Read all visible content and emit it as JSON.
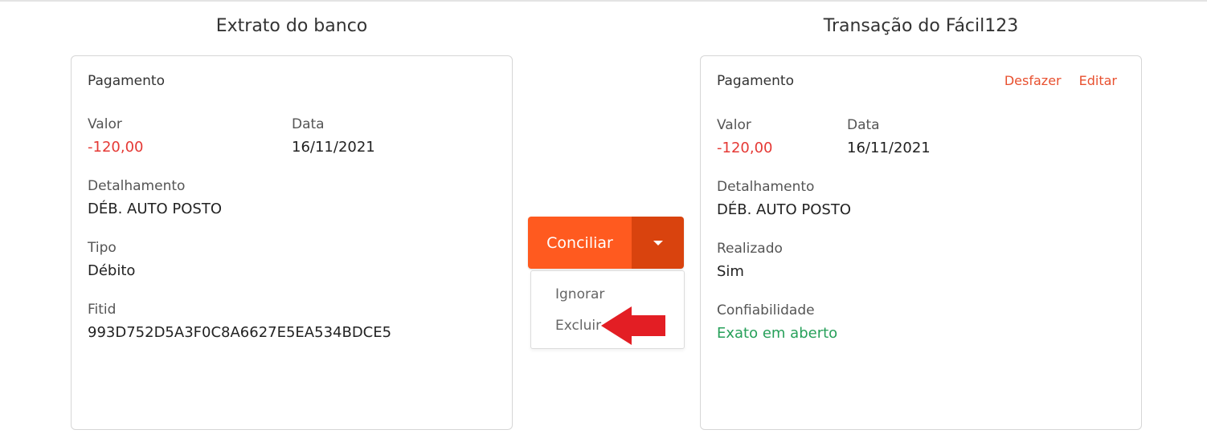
{
  "bank_panel": {
    "heading": "Extrato do banco",
    "card_title": "Pagamento",
    "valor_label": "Valor",
    "valor_value": "-120,00",
    "data_label": "Data",
    "data_value": "16/11/2021",
    "detalhamento_label": "Detalhamento",
    "detalhamento_value": "DÉB. AUTO POSTO",
    "tipo_label": "Tipo",
    "tipo_value": "Débito",
    "fitid_label": "Fitid",
    "fitid_value": "993D752D5A3F0C8A6627E5EA534BDCE5"
  },
  "actions": {
    "primary_label": "Conciliar",
    "caret_icon": "chevron-down-icon",
    "menu_items": [
      "Ignorar",
      "Excluir"
    ],
    "annotation_icon": "red-arrow-left-icon"
  },
  "app_panel": {
    "heading": "Transação do Fácil123",
    "card_title": "Pagamento",
    "undo_label": "Desfazer",
    "edit_label": "Editar",
    "valor_label": "Valor",
    "valor_value": "-120,00",
    "data_label": "Data",
    "data_value": "16/11/2021",
    "detalhamento_label": "Detalhamento",
    "detalhamento_value": "DÉB. AUTO POSTO",
    "realizado_label": "Realizado",
    "realizado_value": "Sim",
    "confiabilidade_label": "Confiabilidade",
    "confiabilidade_value": "Exato em aberto"
  },
  "colors": {
    "accent": "#ff5a1f",
    "accent_dark": "#d9430e",
    "negative": "#e53935",
    "success": "#27a05a",
    "link": "#e8502f",
    "annotation": "#e31e24"
  }
}
